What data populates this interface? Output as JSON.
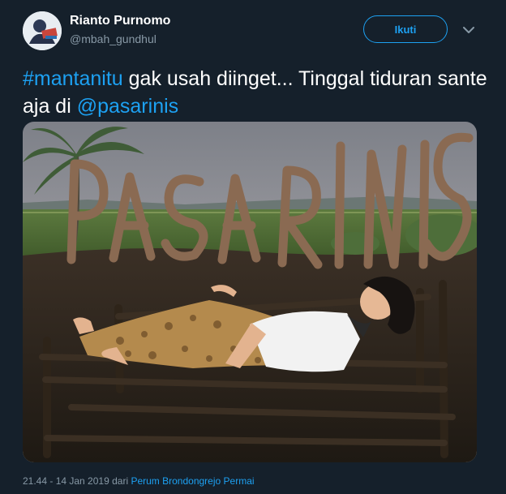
{
  "user": {
    "display_name": "Rianto Purnomo",
    "handle": "@mbah_gundhul"
  },
  "follow_button": {
    "label": "Ikuti"
  },
  "more_menu": {
    "icon": "chevron-down-icon"
  },
  "tweet": {
    "hashtag": "#mantanitu",
    "text_part_1": " gak usah diinget... Tinggal tiduran sante aja di ",
    "mention": "@pasarinis"
  },
  "photo": {
    "sign_text": "PASARINIS",
    "description_icon": "photo"
  },
  "meta": {
    "timestamp": "21.44 - 14 Jan 2019",
    "location_prefix": " dari ",
    "location": "Perum Brondongrejo Permai"
  },
  "colors": {
    "background": "#15202b",
    "accent": "#1da1f2",
    "secondary_text": "#8899a6"
  }
}
